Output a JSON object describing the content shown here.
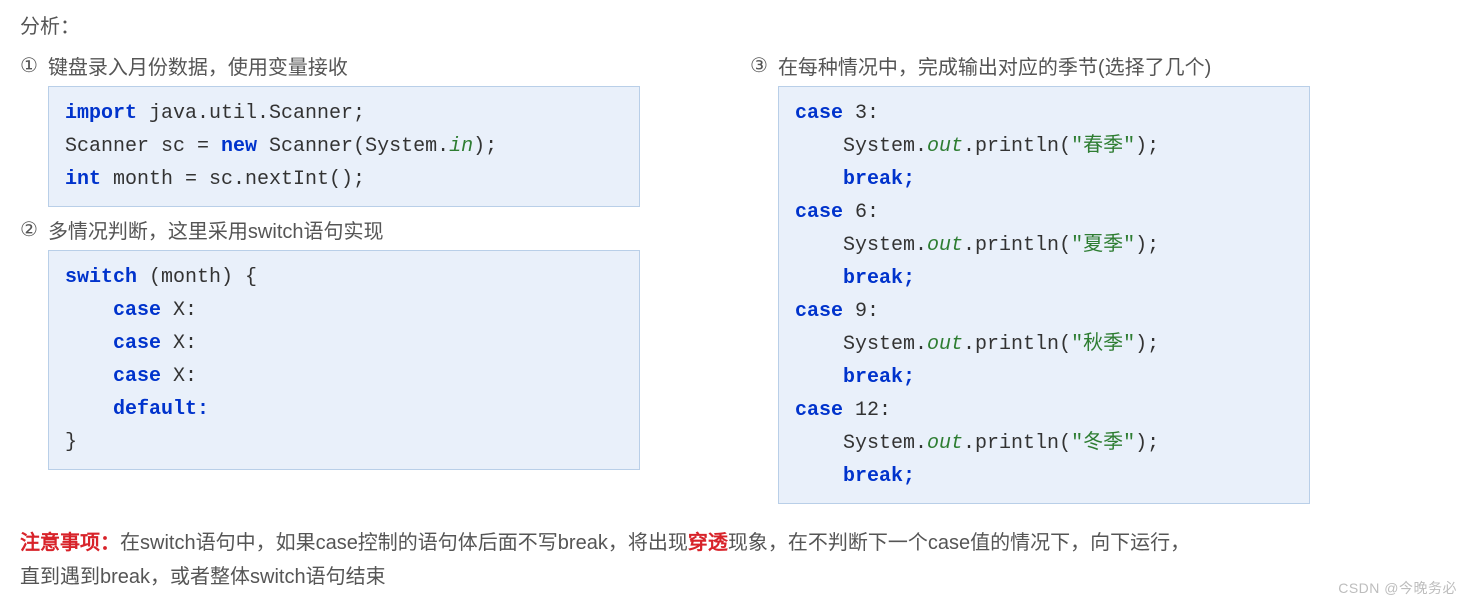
{
  "heading": "分析：",
  "steps": {
    "s1": {
      "num": "①",
      "text": "键盘录入月份数据，使用变量接收"
    },
    "s2": {
      "num": "②",
      "text": "多情况判断，这里采用switch语句实现"
    },
    "s3": {
      "num": "③",
      "text": "在每种情况中，完成输出对应的季节(选择了几个)"
    }
  },
  "code1": {
    "k_import": "import",
    "pkg": " java.util.Scanner;",
    "scanner_decl": "Scanner sc = ",
    "k_new": "new",
    "scanner_tail": " Scanner(System.",
    "in": "in",
    "scanner_end": ");",
    "k_int": "int",
    "month_line": " month = sc.nextInt();"
  },
  "code2": {
    "k_switch": "switch",
    "head_tail": " (month) {",
    "k_case": "case",
    "case_tail": " X:",
    "k_default": "default:",
    "close": "}"
  },
  "code3": {
    "k_case": "case",
    "c3": " 3:",
    "c6": " 6:",
    "c9": " 9:",
    "c12": " 12:",
    "sys_pre": "System.",
    "out": "out",
    "print_pre": ".println(",
    "q": "\"",
    "spring": "春季",
    "summer": "夏季",
    "autumn": "秋季",
    "winter": "冬季",
    "print_post": ");",
    "k_break": "break;"
  },
  "note": {
    "label": "注意事项：",
    "p1": "在switch语句中，如果case控制的语句体后面不写break，将出现",
    "hl": "穿透",
    "p2": "现象，在不判断下一个case值的情况下，向下运行，",
    "p3": "直到遇到break，或者整体switch语句结束"
  },
  "watermark": "CSDN @今晚务必"
}
